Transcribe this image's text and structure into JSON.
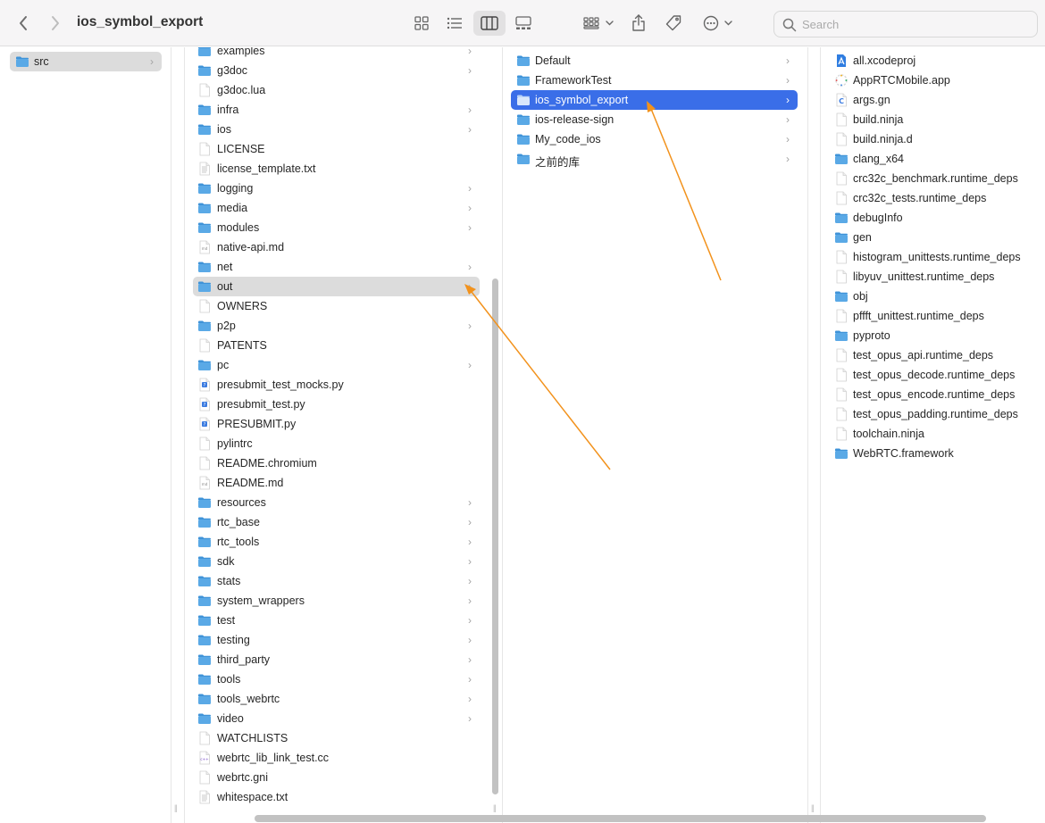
{
  "window": {
    "title": "ios_symbol_export"
  },
  "search": {
    "placeholder": "Search",
    "value": ""
  },
  "toolbar": {
    "back_icon": "chevron-left",
    "forward_icon": "chevron-right",
    "views": [
      "icon-view",
      "list-view",
      "column-view",
      "gallery-view"
    ],
    "active_view": "column-view",
    "group_icon": "group-grid",
    "share_icon": "share",
    "tag_icon": "tag",
    "more_icon": "ellipsis-circle"
  },
  "colors": {
    "selection_blue": "#3a6ee8",
    "selection_grey": "#dcdcdc",
    "folder": "#5aa9e6",
    "arrow": "#f2921c"
  },
  "column1": {
    "items": [
      {
        "name": "src",
        "type": "folder",
        "has_children": true,
        "selected": "grey"
      }
    ]
  },
  "column2": {
    "items": [
      {
        "name": "examples",
        "type": "folder",
        "has_children": true
      },
      {
        "name": "g3doc",
        "type": "folder",
        "has_children": true
      },
      {
        "name": "g3doc.lua",
        "type": "file"
      },
      {
        "name": "infra",
        "type": "folder",
        "has_children": true
      },
      {
        "name": "ios",
        "type": "folder",
        "has_children": true
      },
      {
        "name": "LICENSE",
        "type": "file"
      },
      {
        "name": "license_template.txt",
        "type": "text"
      },
      {
        "name": "logging",
        "type": "folder",
        "has_children": true
      },
      {
        "name": "media",
        "type": "folder",
        "has_children": true
      },
      {
        "name": "modules",
        "type": "folder",
        "has_children": true
      },
      {
        "name": "native-api.md",
        "type": "md"
      },
      {
        "name": "net",
        "type": "folder",
        "has_children": true
      },
      {
        "name": "out",
        "type": "folder",
        "has_children": true,
        "selected": "grey"
      },
      {
        "name": "OWNERS",
        "type": "file"
      },
      {
        "name": "p2p",
        "type": "folder",
        "has_children": true
      },
      {
        "name": "PATENTS",
        "type": "file"
      },
      {
        "name": "pc",
        "type": "folder",
        "has_children": true
      },
      {
        "name": "presubmit_test_mocks.py",
        "type": "py"
      },
      {
        "name": "presubmit_test.py",
        "type": "py"
      },
      {
        "name": "PRESUBMIT.py",
        "type": "py"
      },
      {
        "name": "pylintrc",
        "type": "file"
      },
      {
        "name": "README.chromium",
        "type": "file"
      },
      {
        "name": "README.md",
        "type": "md"
      },
      {
        "name": "resources",
        "type": "folder",
        "has_children": true
      },
      {
        "name": "rtc_base",
        "type": "folder",
        "has_children": true
      },
      {
        "name": "rtc_tools",
        "type": "folder",
        "has_children": true
      },
      {
        "name": "sdk",
        "type": "folder",
        "has_children": true
      },
      {
        "name": "stats",
        "type": "folder",
        "has_children": true
      },
      {
        "name": "system_wrappers",
        "type": "folder",
        "has_children": true
      },
      {
        "name": "test",
        "type": "folder",
        "has_children": true
      },
      {
        "name": "testing",
        "type": "folder",
        "has_children": true
      },
      {
        "name": "third_party",
        "type": "folder",
        "has_children": true
      },
      {
        "name": "tools",
        "type": "folder",
        "has_children": true
      },
      {
        "name": "tools_webrtc",
        "type": "folder",
        "has_children": true
      },
      {
        "name": "video",
        "type": "folder",
        "has_children": true
      },
      {
        "name": "WATCHLISTS",
        "type": "file"
      },
      {
        "name": "webrtc_lib_link_test.cc",
        "type": "cc"
      },
      {
        "name": "webrtc.gni",
        "type": "file"
      },
      {
        "name": "whitespace.txt",
        "type": "text"
      }
    ]
  },
  "column3": {
    "items": [
      {
        "name": "Default",
        "type": "folder",
        "has_children": true
      },
      {
        "name": "FrameworkTest",
        "type": "folder",
        "has_children": true
      },
      {
        "name": "ios_symbol_export",
        "type": "folder",
        "has_children": true,
        "selected": "blue"
      },
      {
        "name": "ios-release-sign",
        "type": "folder",
        "has_children": true
      },
      {
        "name": "My_code_ios",
        "type": "folder",
        "has_children": true
      },
      {
        "name": "之前的库",
        "type": "folder",
        "has_children": true
      }
    ]
  },
  "column4": {
    "items": [
      {
        "name": "all.xcodeproj",
        "type": "xcodeproj"
      },
      {
        "name": "AppRTCMobile.app",
        "type": "app"
      },
      {
        "name": "args.gn",
        "type": "c"
      },
      {
        "name": "build.ninja",
        "type": "file"
      },
      {
        "name": "build.ninja.d",
        "type": "file"
      },
      {
        "name": "clang_x64",
        "type": "folder"
      },
      {
        "name": "crc32c_benchmark.runtime_deps",
        "type": "file"
      },
      {
        "name": "crc32c_tests.runtime_deps",
        "type": "file"
      },
      {
        "name": "debugInfo",
        "type": "folder"
      },
      {
        "name": "gen",
        "type": "folder"
      },
      {
        "name": "histogram_unittests.runtime_deps",
        "type": "file"
      },
      {
        "name": "libyuv_unittest.runtime_deps",
        "type": "file"
      },
      {
        "name": "obj",
        "type": "folder"
      },
      {
        "name": "pffft_unittest.runtime_deps",
        "type": "file"
      },
      {
        "name": "pyproto",
        "type": "folder"
      },
      {
        "name": "test_opus_api.runtime_deps",
        "type": "file"
      },
      {
        "name": "test_opus_decode.runtime_deps",
        "type": "file"
      },
      {
        "name": "test_opus_encode.runtime_deps",
        "type": "file"
      },
      {
        "name": "test_opus_padding.runtime_deps",
        "type": "file"
      },
      {
        "name": "toolchain.ninja",
        "type": "file"
      },
      {
        "name": "WebRTC.framework",
        "type": "folder"
      }
    ]
  }
}
